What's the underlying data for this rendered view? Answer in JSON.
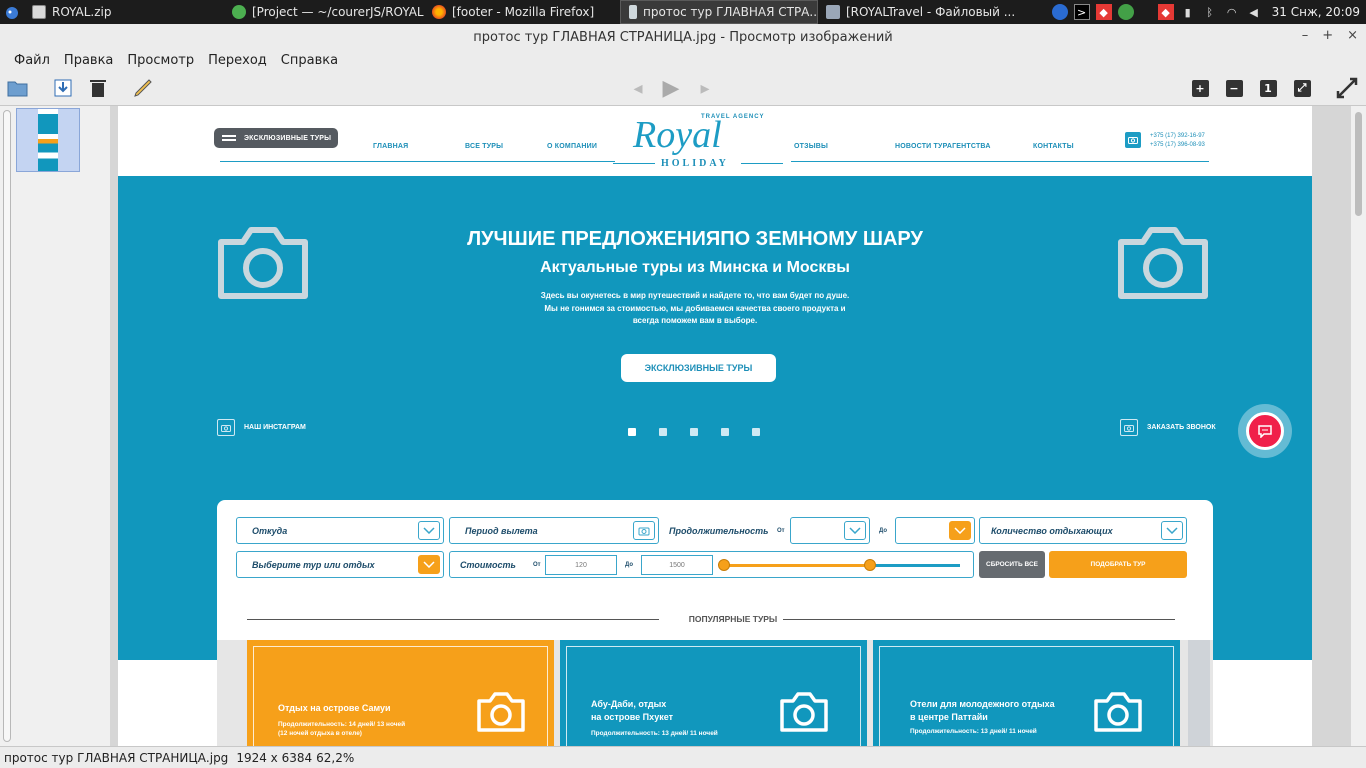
{
  "taskbar": {
    "tasks": [
      {
        "label": "ROYAL.zip",
        "icon": "archive-icon",
        "active": false
      },
      {
        "label": "[Project — ~/courerJS/ROYAL...",
        "icon": "editor-icon",
        "active": false
      },
      {
        "label": "[footer - Mozilla Firefox]",
        "icon": "firefox-icon",
        "active": false
      },
      {
        "label": "протос тур ГЛАВНАЯ СТРА...",
        "icon": "image-viewer-icon",
        "active": true
      },
      {
        "label": "[ROYALTravel - Файловый ...",
        "icon": "folder-icon",
        "active": false
      }
    ],
    "clock": "31 Снж, 20:09"
  },
  "window": {
    "title": "протос тур ГЛАВНАЯ СТРАНИЦА.jpg - Просмотр изображений",
    "menu": [
      "Файл",
      "Правка",
      "Просмотр",
      "Переход",
      "Справка"
    ],
    "zoom_buttons": [
      "+",
      "−",
      "1",
      "⤢"
    ]
  },
  "status": {
    "filename": "протос тур ГЛАВНАЯ СТРАНИЦА.jpg",
    "dimensions": "1924 x 6384",
    "zoom": "62,2%"
  },
  "site": {
    "header": {
      "exclusive_pill": "ЭКСКЛЮЗИВНЫЕ ТУРЫ",
      "nav_left": [
        "ГЛАВНАЯ",
        "ВСЕ ТУРЫ",
        "О КОМПАНИИ"
      ],
      "nav_right": [
        "ОТЗЫВЫ",
        "НОВОСТИ ТУРАГЕНТСТВА",
        "КОНТАКТЫ"
      ],
      "logo_small": "TRAVEL AGENCY",
      "logo_main": "Royal",
      "logo_sub": "HOLIDAY",
      "phone1": "+375 (17) 392-16-97",
      "phone2": "+375 (17) 396-08-93"
    },
    "hero": {
      "title": "ЛУЧШИЕ ПРЕДЛОЖЕНИЯПО ЗЕМНОМУ ШАРУ",
      "subtitle": "Актуальные туры  из Минска и Москвы",
      "desc1": "Здесь вы окунетесь в мир путешествий и найдете то, что вам будет по душе.",
      "desc2": "Мы не гонимся за стоимостью, мы добиваемся качества своего продукта и",
      "desc3": "всегда поможем вам в выборе.",
      "button": "ЭКСКЛЮЗИВНЫЕ ТУРЫ",
      "instagram": "НАШ ИНСТАГРАМ",
      "callback": "ЗАКАЗАТЬ ЗВОНОК",
      "active_slide": 1
    },
    "search": {
      "from": "Откуда",
      "period": "Период вылета",
      "duration": "Продолжительность",
      "duration_from": "От",
      "duration_to": "До",
      "guests": "Количество отдыхающих",
      "tour_type": "Выберите тур или отдых",
      "price": "Стоимость",
      "price_from_label": "От",
      "price_from": "120",
      "price_to_label": "До",
      "price_to": "1500",
      "reset": "СБРОСИТЬ ВСЕ",
      "submit": "ПОДОБРАТЬ ТУР",
      "slider_low": 0.0,
      "slider_high": 0.62
    },
    "popular_title": "ПОПУЛЯРНЫЕ ТУРЫ",
    "tours": [
      {
        "name1": "Отдых на острове Самуи",
        "name2": "",
        "dur1": "Продолжительность: 14 дней/ 13 ночей",
        "dur2": "(12 ночей отдыха в отеле)",
        "color": "#f6a01a"
      },
      {
        "name1": "Абу-Даби, отдых",
        "name2": "на острове Пхукет",
        "dur1": "Продолжительность: 13 дней/ 11 ночей",
        "dur2": "",
        "color": "#1197bd"
      },
      {
        "name1": "Отели для молодежного отдыха",
        "name2": "в центре Паттайи",
        "dur1": "Продолжительность: 13 дней/ 11 ночей",
        "dur2": "",
        "color": "#1197bd"
      }
    ]
  }
}
